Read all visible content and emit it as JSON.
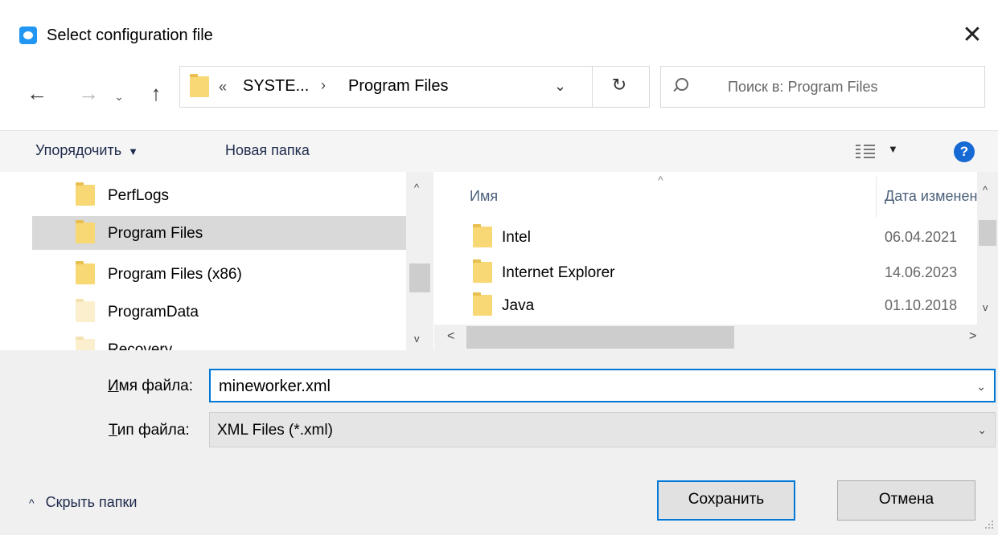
{
  "window": {
    "title": "Select configuration file",
    "close_glyph": "✕"
  },
  "nav": {
    "back_glyph": "←",
    "forward_glyph": "→",
    "recent_glyph": "⌄",
    "up_glyph": "↑",
    "address": {
      "overflow_glyph": "«",
      "segments": [
        "SYSTE...",
        "Program Files"
      ],
      "separator": "›",
      "dropdown_glyph": "⌄",
      "refresh_glyph": "↻"
    },
    "search": {
      "placeholder": "Поиск в: Program Files"
    }
  },
  "toolbar": {
    "organize_label": "Упорядочить",
    "caret": "▼",
    "new_folder_label": "Новая папка",
    "help_label": "?"
  },
  "nav_pane": {
    "items": [
      {
        "label": "PerfLogs",
        "selected": false,
        "hidden": false
      },
      {
        "label": "Program Files",
        "selected": true,
        "hidden": false
      },
      {
        "label": "Program Files (x86)",
        "selected": false,
        "hidden": false
      },
      {
        "label": "ProgramData",
        "selected": false,
        "hidden": true
      },
      {
        "label": "Recovery",
        "selected": false,
        "hidden": true
      }
    ]
  },
  "file_list": {
    "columns": {
      "name": "Имя",
      "date": "Дата изменения"
    },
    "sort_glyph": "^",
    "rows": [
      {
        "name": "Intel",
        "date": "06.04.2021"
      },
      {
        "name": "Internet Explorer",
        "date": "14.06.2023"
      },
      {
        "name": "Java",
        "date": "01.10.2018"
      }
    ]
  },
  "scroll_glyphs": {
    "up": "^",
    "down": "v",
    "left": "<",
    "right": ">"
  },
  "form": {
    "filename_label_accel": "И",
    "filename_label_rest": "мя файла:",
    "filename_value": "mineworker.xml",
    "filetype_label_accel": "Т",
    "filetype_label_rest": "ип файла:",
    "filetype_value": "XML Files (*.xml)",
    "dropdown_glyph": "⌄"
  },
  "footer": {
    "hide_folders_glyph": "^",
    "hide_folders_label": "Скрыть папки",
    "save_label": "Сохранить",
    "cancel_label": "Отмена"
  },
  "colors": {
    "accent": "#0078d7",
    "help_blue": "#1769d4",
    "folder": "#f8d775",
    "selection": "#d9d9d9"
  }
}
